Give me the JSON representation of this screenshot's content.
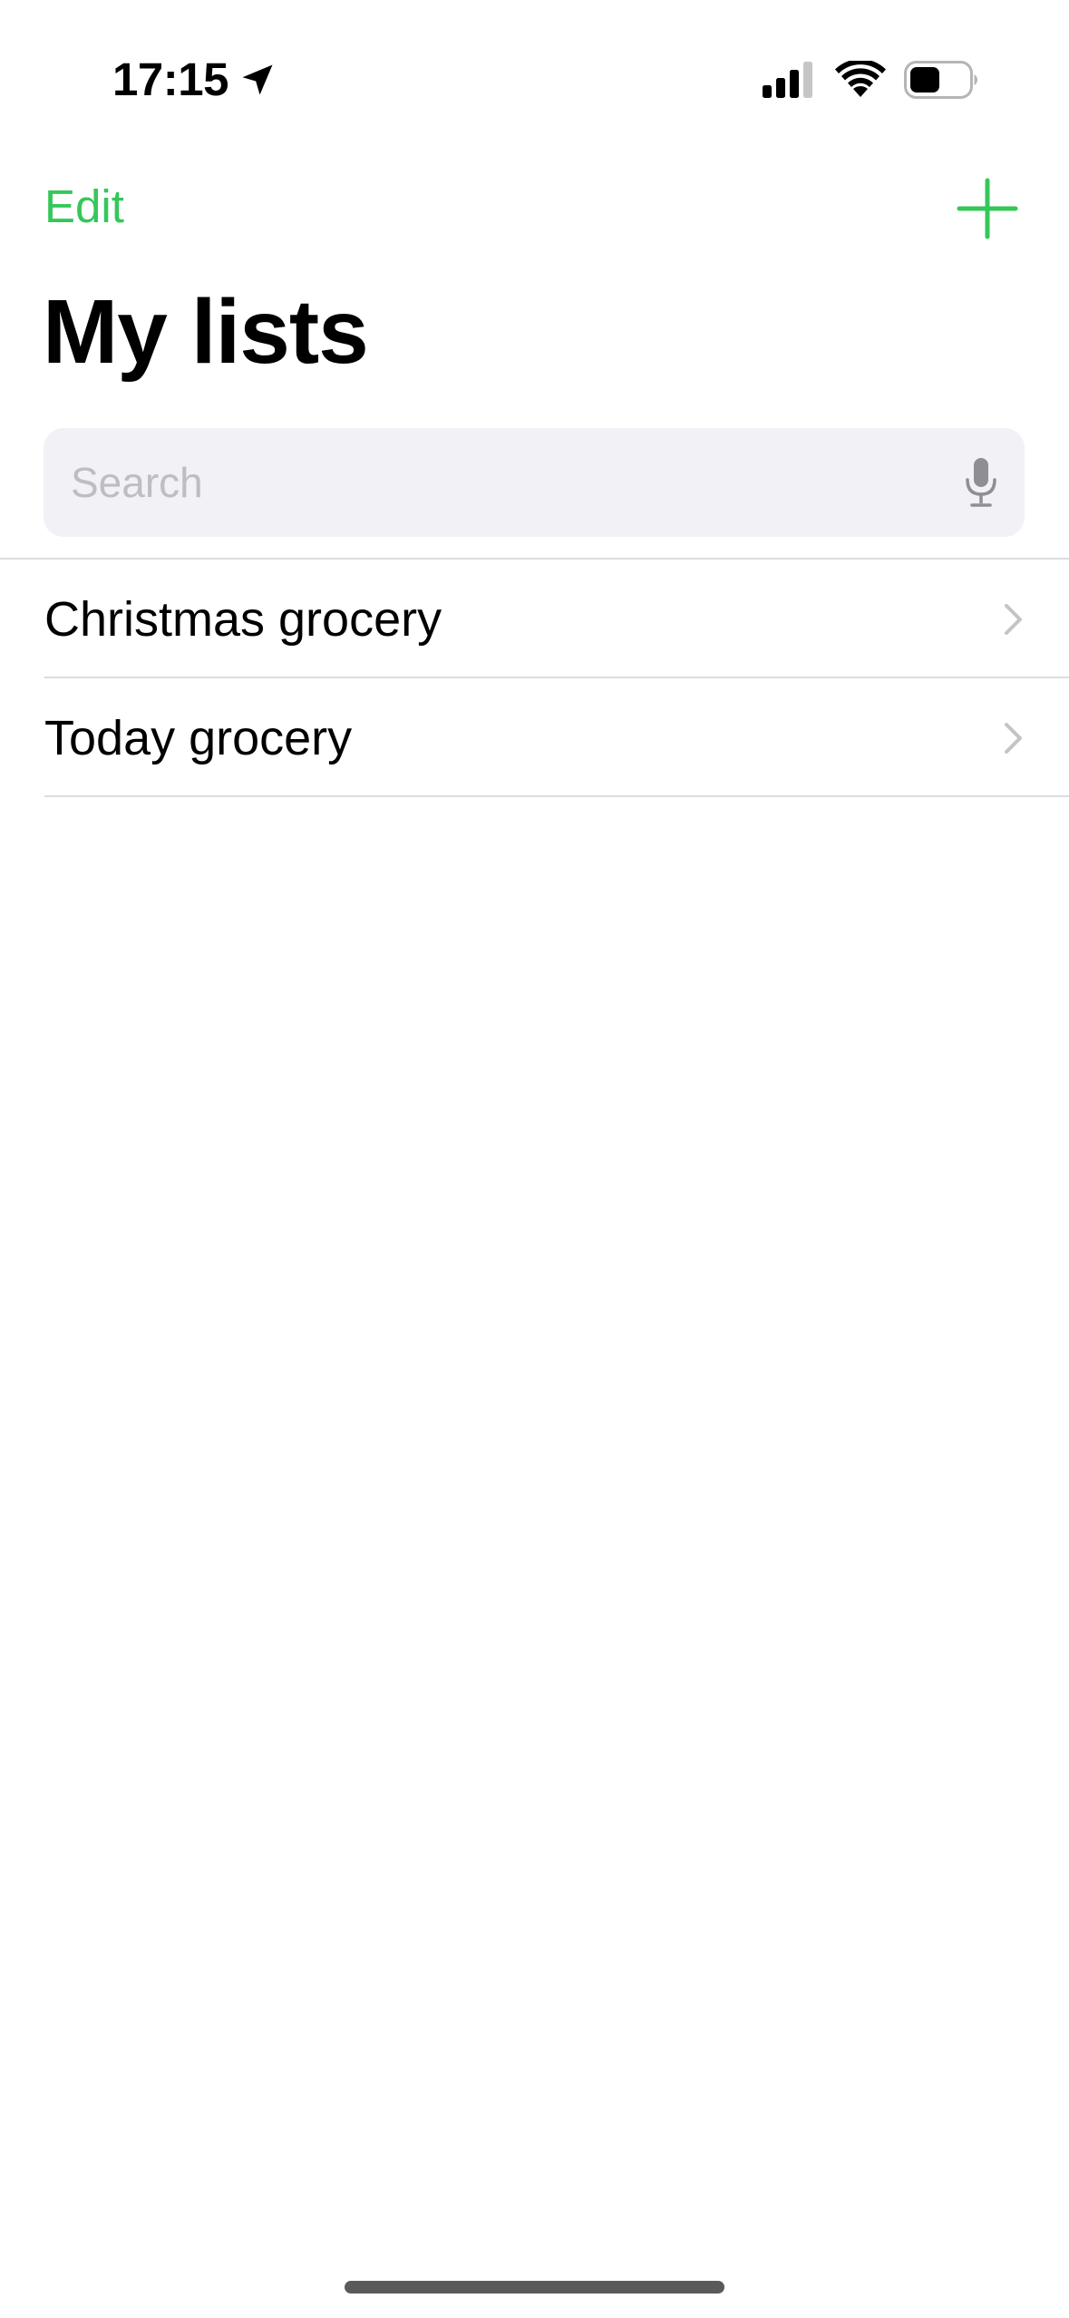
{
  "status_bar": {
    "time": "17:15",
    "icons": [
      "location-arrow-icon",
      "cellular-signal-icon",
      "wifi-icon",
      "battery-icon"
    ]
  },
  "nav": {
    "edit_label": "Edit",
    "add_icon": "plus-icon"
  },
  "title": "My lists",
  "search": {
    "placeholder": "Search",
    "value": "",
    "mic_icon": "microphone-icon"
  },
  "lists": [
    {
      "label": "Christmas grocery",
      "icon": "chevron-right-icon"
    },
    {
      "label": "Today grocery",
      "icon": "chevron-right-icon"
    }
  ],
  "colors": {
    "accent": "#34c759",
    "search_background": "#f1f1f6",
    "placeholder": "#bdbdc4",
    "separator": "#dcdcdf",
    "chevron": "#c4c4c7"
  }
}
